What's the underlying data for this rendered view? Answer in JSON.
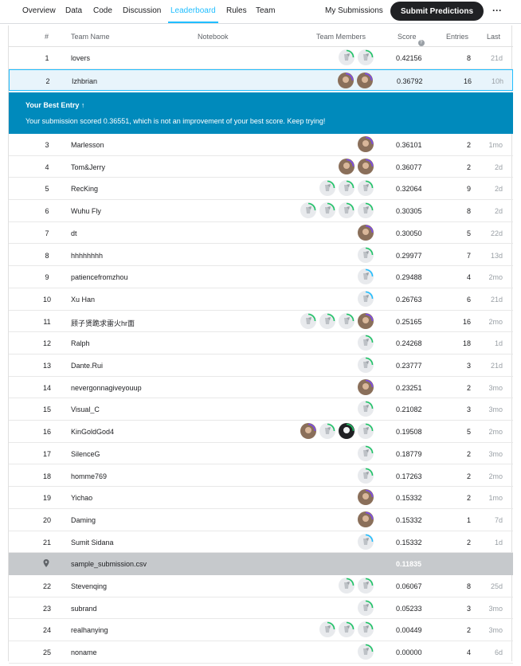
{
  "nav": {
    "tabs": [
      {
        "label": "Overview"
      },
      {
        "label": "Data"
      },
      {
        "label": "Code"
      },
      {
        "label": "Discussion"
      },
      {
        "label": "Leaderboard"
      },
      {
        "label": "Rules"
      },
      {
        "label": "Team"
      }
    ],
    "active_tab": "Leaderboard",
    "my_submissions": "My Submissions",
    "submit": "Submit Predictions",
    "more": "···"
  },
  "table": {
    "headers": {
      "rank": "#",
      "team": "Team Name",
      "notebook": "Notebook",
      "members": "Team Members",
      "score": "Score",
      "entries": "Entries",
      "last": "Last"
    }
  },
  "banner": {
    "title": "Your Best Entry ↑",
    "message": "Your submission scored 0.36551, which is not an improvement of your best score. Keep trying!"
  },
  "rows": [
    {
      "rank": "1",
      "team": "lovers",
      "score": "0.42156",
      "entries": "8",
      "last": "21d",
      "avatars": [
        "g",
        "g"
      ]
    },
    {
      "rank": "2",
      "team": "Izhbrian",
      "score": "0.36792",
      "entries": "16",
      "last": "10h",
      "avatars": [
        "p",
        "p"
      ]
    },
    {
      "rank": "3",
      "team": "Marlesson",
      "score": "0.36101",
      "entries": "2",
      "last": "1mo",
      "avatars": [
        "p"
      ]
    },
    {
      "rank": "4",
      "team": "Tom&Jerry",
      "score": "0.36077",
      "entries": "2",
      "last": "2d",
      "avatars": [
        "p",
        "p"
      ]
    },
    {
      "rank": "5",
      "team": "RecKing",
      "score": "0.32064",
      "entries": "9",
      "last": "2d",
      "avatars": [
        "g",
        "g",
        "g"
      ]
    },
    {
      "rank": "6",
      "team": "Wuhu Fly",
      "score": "0.30305",
      "entries": "8",
      "last": "2d",
      "avatars": [
        "g",
        "g",
        "g",
        "g"
      ]
    },
    {
      "rank": "7",
      "team": "dt",
      "score": "0.30050",
      "entries": "5",
      "last": "22d",
      "avatars": [
        "p"
      ]
    },
    {
      "rank": "8",
      "team": "hhhhhhhh",
      "score": "0.29977",
      "entries": "7",
      "last": "13d",
      "avatars": [
        "g"
      ]
    },
    {
      "rank": "9",
      "team": "patiencefromzhou",
      "score": "0.29488",
      "entries": "4",
      "last": "2mo",
      "avatars": [
        "b"
      ]
    },
    {
      "rank": "10",
      "team": "Xu Han",
      "score": "0.26763",
      "entries": "6",
      "last": "21d",
      "avatars": [
        "b"
      ]
    },
    {
      "rank": "11",
      "team": "顾子贤跪求雷火hr面",
      "score": "0.25165",
      "entries": "16",
      "last": "2mo",
      "avatars": [
        "p",
        "g",
        "g",
        "g"
      ]
    },
    {
      "rank": "12",
      "team": "Ralph",
      "score": "0.24268",
      "entries": "18",
      "last": "1d",
      "avatars": [
        "g"
      ]
    },
    {
      "rank": "13",
      "team": "Dante.Rui",
      "score": "0.23777",
      "entries": "3",
      "last": "21d",
      "avatars": [
        "g"
      ]
    },
    {
      "rank": "14",
      "team": "nevergonnagiveyouup",
      "score": "0.23251",
      "entries": "2",
      "last": "3mo",
      "avatars": [
        "p"
      ]
    },
    {
      "rank": "15",
      "team": "Visual_C",
      "score": "0.21082",
      "entries": "3",
      "last": "3mo",
      "avatars": [
        "g"
      ]
    },
    {
      "rank": "16",
      "team": "KinGoldGod4",
      "score": "0.19508",
      "entries": "5",
      "last": "2mo",
      "avatars": [
        "g",
        "d",
        "g",
        "p"
      ]
    },
    {
      "rank": "17",
      "team": "SilenceG",
      "score": "0.18779",
      "entries": "2",
      "last": "3mo",
      "avatars": [
        "g"
      ]
    },
    {
      "rank": "18",
      "team": "homme769",
      "score": "0.17263",
      "entries": "2",
      "last": "2mo",
      "avatars": [
        "g"
      ]
    },
    {
      "rank": "19",
      "team": "Yichao",
      "score": "0.15332",
      "entries": "2",
      "last": "1mo",
      "avatars": [
        "p"
      ]
    },
    {
      "rank": "20",
      "team": "Daming",
      "score": "0.15332",
      "entries": "1",
      "last": "7d",
      "avatars": [
        "p"
      ]
    },
    {
      "rank": "21",
      "team": "Sumit Sidana",
      "score": "0.15332",
      "entries": "2",
      "last": "1d",
      "avatars": [
        "b"
      ]
    },
    {
      "rank": "",
      "team": "sample_submission.csv",
      "score": "0.11835",
      "entries": "",
      "last": "",
      "avatars": [],
      "benchmark": true
    },
    {
      "rank": "22",
      "team": "Stevenqing",
      "score": "0.06067",
      "entries": "8",
      "last": "25d",
      "avatars": [
        "g",
        "g"
      ]
    },
    {
      "rank": "23",
      "team": "subrand",
      "score": "0.05233",
      "entries": "3",
      "last": "3mo",
      "avatars": [
        "g"
      ]
    },
    {
      "rank": "24",
      "team": "realhanying",
      "score": "0.00449",
      "entries": "2",
      "last": "3mo",
      "avatars": [
        "g",
        "g",
        "g"
      ]
    },
    {
      "rank": "25",
      "team": "noname",
      "score": "0.00000",
      "entries": "4",
      "last": "6d",
      "avatars": [
        "g"
      ]
    }
  ],
  "colors": {
    "accent": "#20beff",
    "banner": "#008abc",
    "selected_row": "#e8f4fb",
    "benchmark_row": "#c6c9cc",
    "ring_green": "#1ec466",
    "ring_purple": "#7b4bf0",
    "ring_blue": "#20beff"
  }
}
